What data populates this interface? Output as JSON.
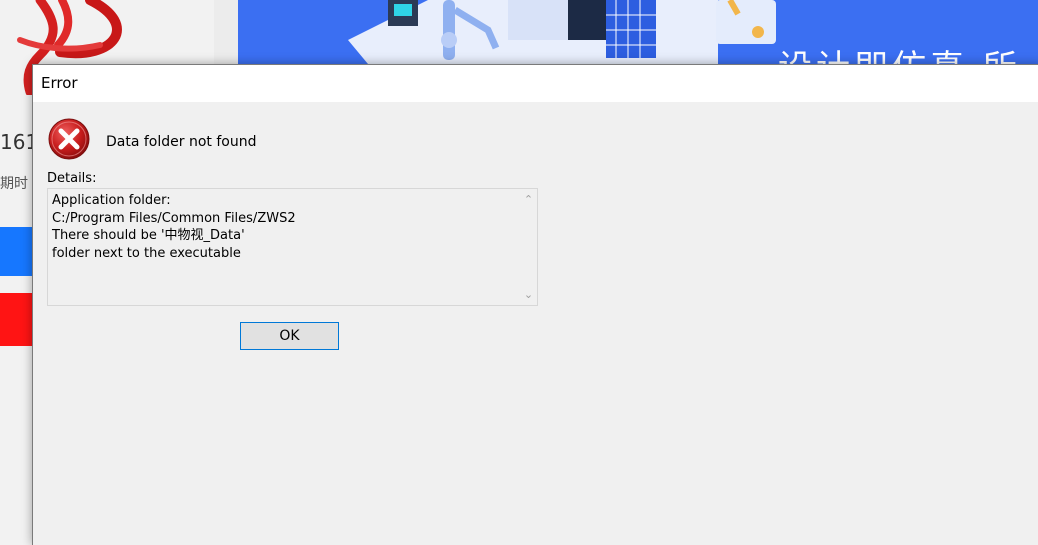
{
  "background_app": {
    "number_fragment": "161",
    "text_fragment": "期时",
    "banner_text": "设计即仿真 所"
  },
  "dialog": {
    "title": "Error",
    "icon": "error-icon",
    "message": "Data folder not found",
    "details_label": "Details:",
    "details_lines": [
      "Application folder:",
      "C:/Program Files/Common Files/ZWS2",
      "There should be '中物视_Data'",
      "folder next to the executable"
    ],
    "ok_label": "OK"
  }
}
